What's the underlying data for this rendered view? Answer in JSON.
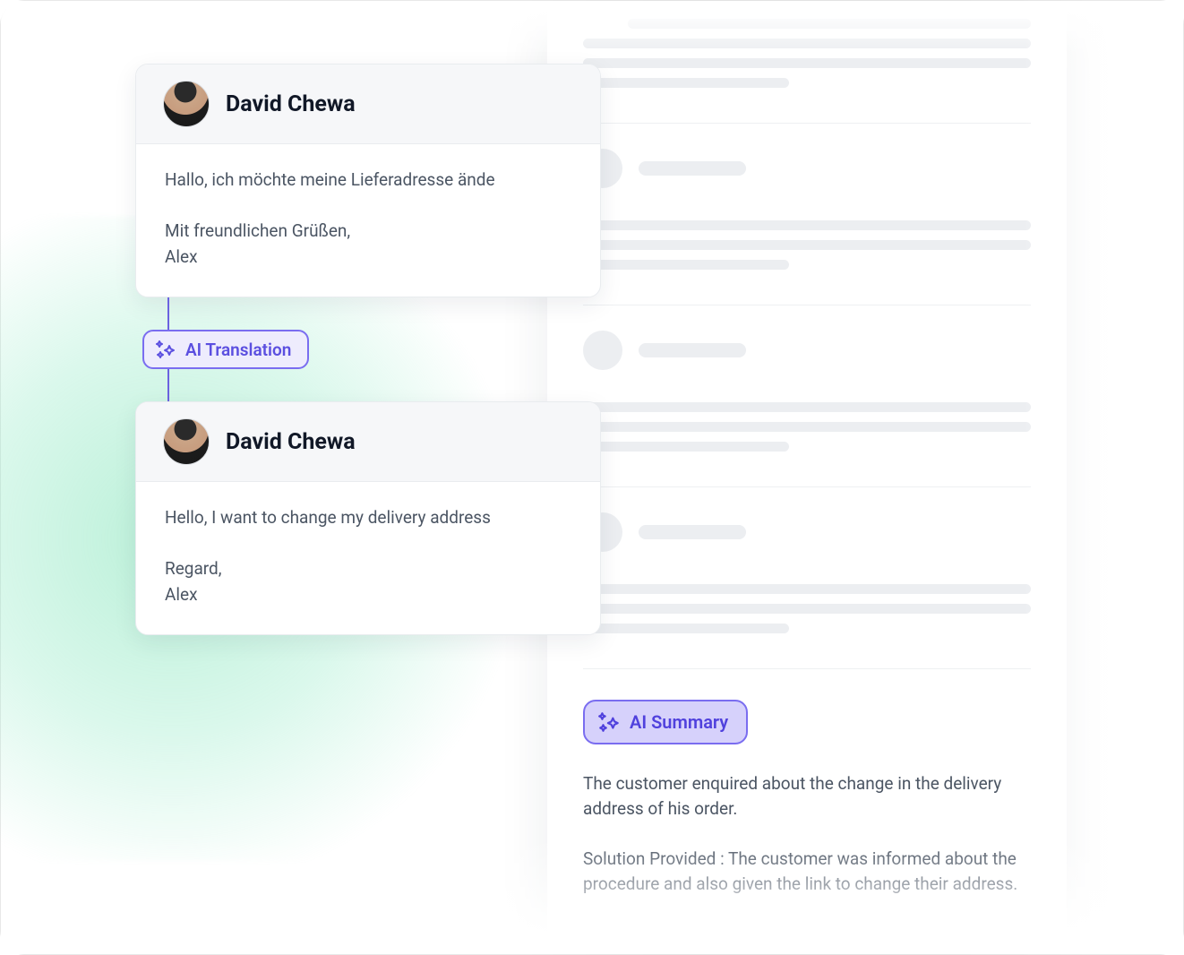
{
  "sender": {
    "name": "David Chewa"
  },
  "original_message": "Hallo, ich möchte meine Lieferadresse ände\n\nMit freundlichen Grüßen,\nAlex",
  "translation_chip": {
    "label": "AI Translation"
  },
  "translated_message": "Hello, I want to change my delivery address\n\nRegard,\nAlex",
  "summary_chip": {
    "label": "AI Summary"
  },
  "summary_text": "The customer enquired about the change in the delivery address of his order.\n\nSolution Provided : The customer was informed about the procedure and also given the link to change their address.",
  "colors": {
    "accent": "#5b4fe0",
    "chip_bg": "#eeecfd",
    "chip_border": "#7a6df0"
  }
}
